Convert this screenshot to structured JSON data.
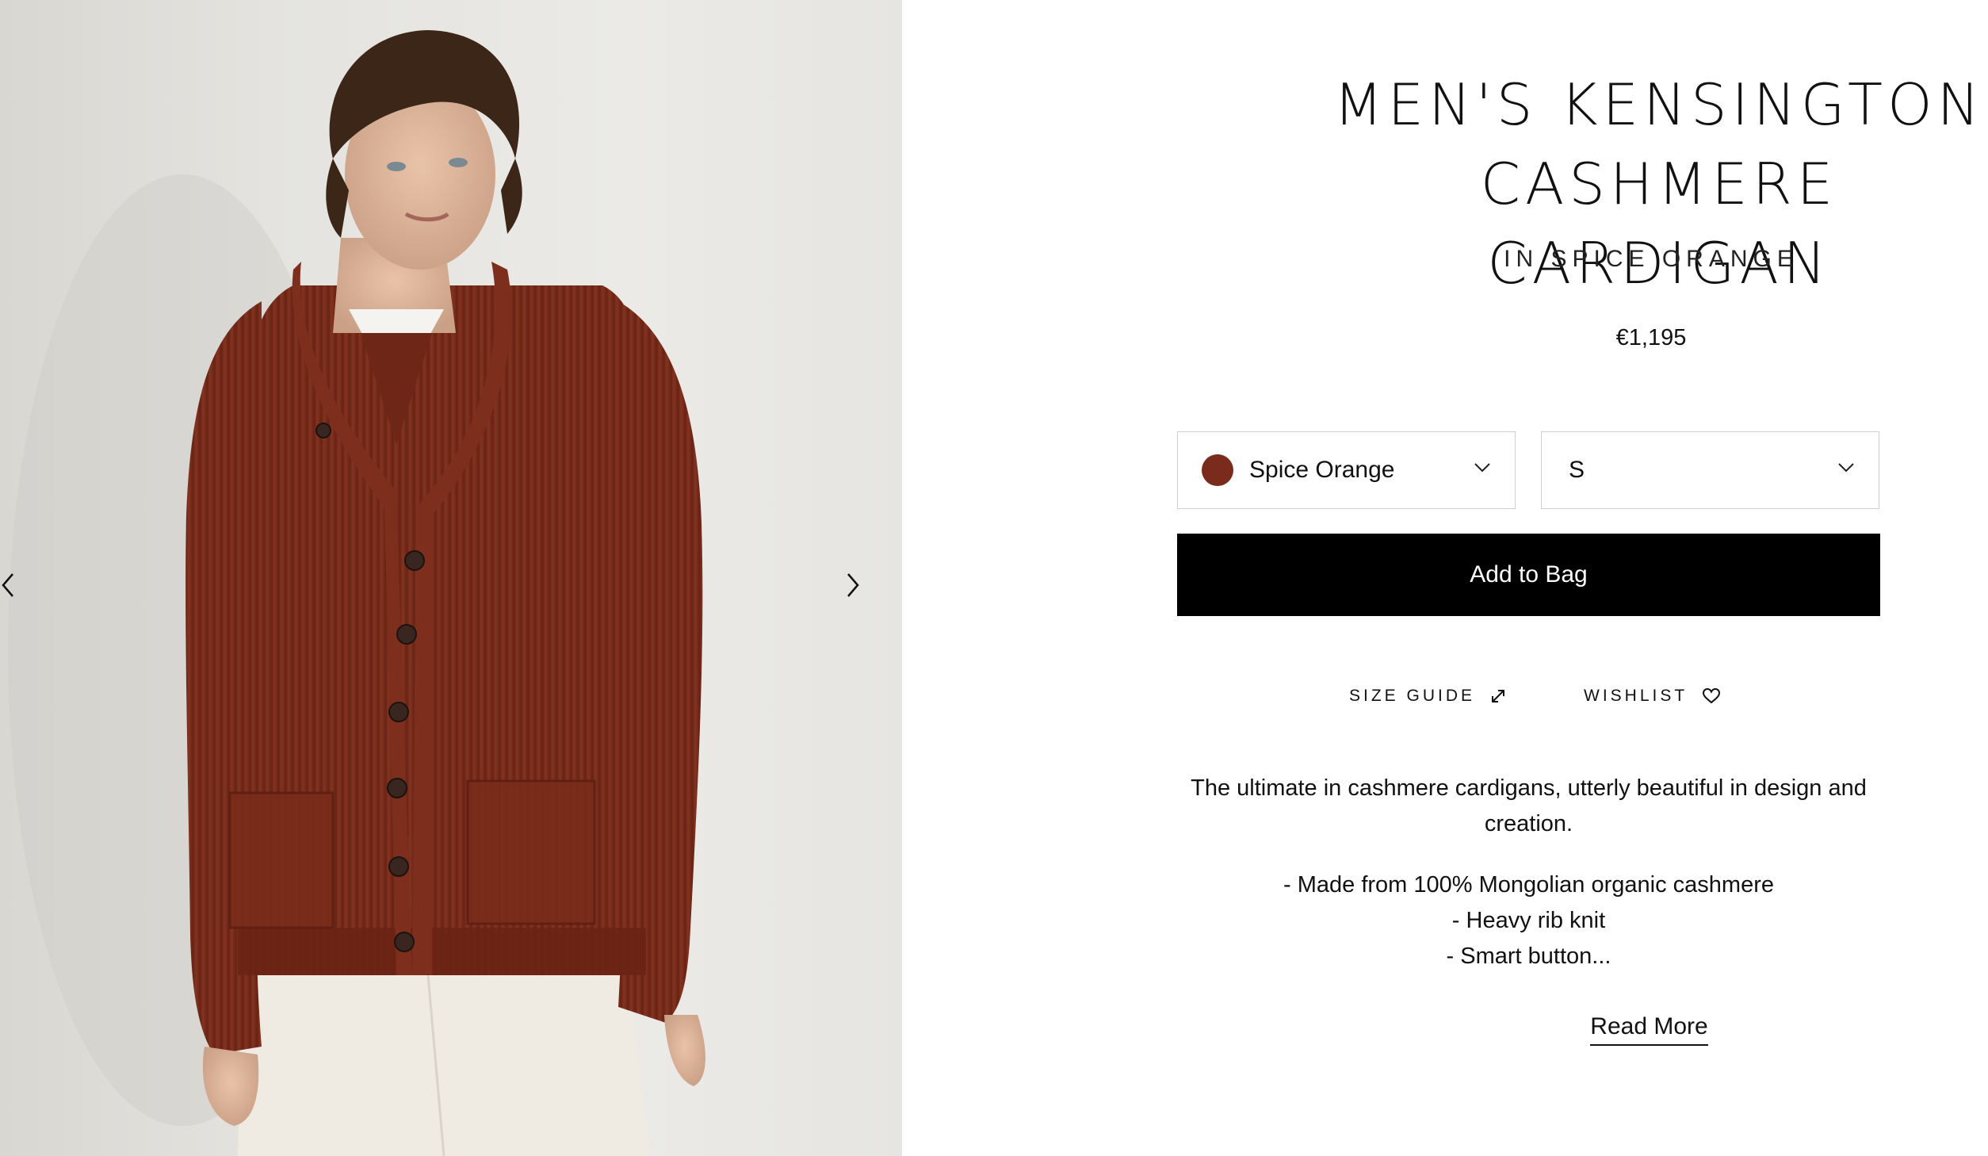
{
  "gallery": {
    "image_alt": "Model wearing Men's Kensington Cashmere Cardigan in Spice Orange",
    "prev_icon": "chevron-left-icon",
    "next_icon": "chevron-right-icon"
  },
  "product": {
    "title_line_1": "MEN'S KENSINGTON",
    "title_line_2": "CASHMERE CARDIGAN",
    "subtitle": "IN SPICE ORANGE",
    "price": "€1,195",
    "color_select": {
      "value": "Spice Orange",
      "swatch_color": "#7b2b1c",
      "icon": "chevron-down-icon"
    },
    "size_select": {
      "value": "S",
      "icon": "chevron-down-icon"
    },
    "add_to_bag_label": "Add to Bag",
    "size_guide_label": "SIZE GUIDE",
    "size_guide_icon": "expand-arrows-icon",
    "wishlist_label": "WISHLIST",
    "wishlist_icon": "heart-icon",
    "description": "The ultimate in cashmere cardigans, utterly beautiful in design and creation.",
    "bullets": [
      "- Made from 100% Mongolian organic cashmere",
      "- Heavy rib knit",
      "- Smart button..."
    ],
    "read_more_label": "Read More"
  },
  "colors": {
    "accent": "#000000",
    "cardigan": "#7b2b1c",
    "background": "#ffffff"
  }
}
